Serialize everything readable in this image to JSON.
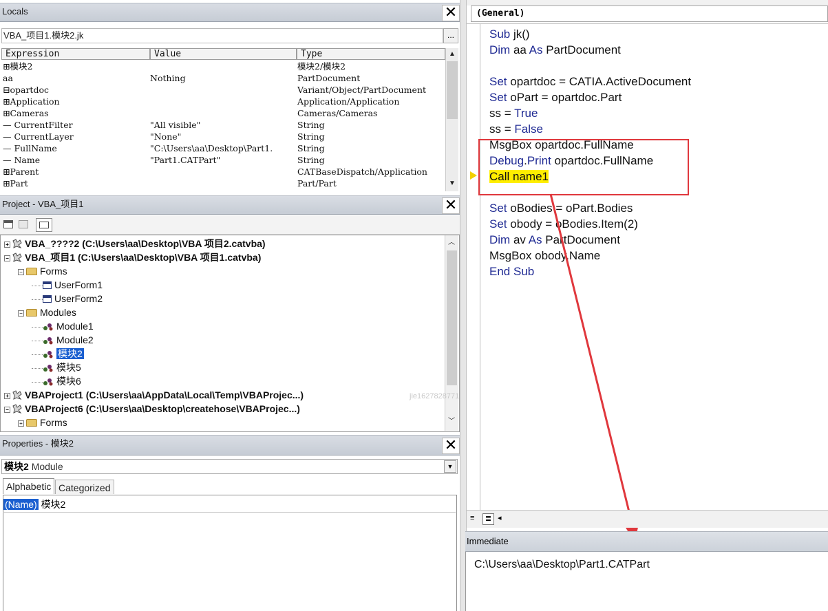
{
  "locals": {
    "title": "Locals",
    "context": "VBA_项目1.模块2.jk",
    "ellipsis": "...",
    "columns": [
      "Expression",
      "Value",
      "Type"
    ],
    "rows": [
      {
        "expr": "⊞模块2",
        "value": "",
        "type": "模块2/模块2"
      },
      {
        "expr": " aa",
        "value": "Nothing",
        "type": "PartDocument"
      },
      {
        "expr": "⊟opartdoc",
        "value": "",
        "type": "Variant/Object/PartDocument"
      },
      {
        "expr": " ⊞Application",
        "value": "",
        "type": "Application/Application"
      },
      {
        "expr": " ⊞Cameras",
        "value": "",
        "type": "Cameras/Cameras"
      },
      {
        "expr": " — CurrentFilter",
        "value": "\"All visible\"",
        "type": "String"
      },
      {
        "expr": " — CurrentLayer",
        "value": "\"None\"",
        "type": "String"
      },
      {
        "expr": " — FullName",
        "value": "\"C:\\Users\\aa\\Desktop\\Part1.",
        "type": "String"
      },
      {
        "expr": " — Name",
        "value": "\"Part1.CATPart\"",
        "type": "String"
      },
      {
        "expr": " ⊞Parent",
        "value": "",
        "type": "CATBaseDispatch/Application"
      },
      {
        "expr": " ⊞Part",
        "value": "",
        "type": "Part/Part"
      }
    ]
  },
  "project": {
    "title": "Project - VBA_项目1",
    "tree": [
      {
        "label": "VBA_????2 (C:\\Users\\aa\\Desktop\\VBA 项目2.catvba)",
        "kind": "project",
        "expander": "+"
      },
      {
        "label": "VBA_项目1 (C:\\Users\\aa\\Desktop\\VBA 项目1.catvba)",
        "kind": "project",
        "expander": "−"
      },
      {
        "label": "Forms",
        "kind": "folder",
        "expander": "−"
      },
      {
        "label": "UserForm1",
        "kind": "form"
      },
      {
        "label": "UserForm2",
        "kind": "form"
      },
      {
        "label": "Modules",
        "kind": "folder",
        "expander": "−"
      },
      {
        "label": "Module1",
        "kind": "module"
      },
      {
        "label": "Module2",
        "kind": "module"
      },
      {
        "label": "模块2",
        "kind": "module",
        "selected": true
      },
      {
        "label": "模块5",
        "kind": "module"
      },
      {
        "label": "模块6",
        "kind": "module"
      },
      {
        "label": "VBAProject1 (C:\\Users\\aa\\AppData\\Local\\Temp\\VBAProjec...)",
        "kind": "project",
        "expander": "+"
      },
      {
        "label": "VBAProject6 (C:\\Users\\aa\\Desktop\\createhose\\VBAProjec...)",
        "kind": "project",
        "expander": "−"
      },
      {
        "label": "Forms",
        "kind": "folder",
        "expander": "+"
      }
    ]
  },
  "properties": {
    "title": "Properties - 模块2",
    "object_name": "模块2",
    "object_type": "Module",
    "tabs": [
      "Alphabetic",
      "Categorized"
    ],
    "rows": [
      {
        "name": "(Name)",
        "value": "模块2"
      }
    ]
  },
  "code": {
    "object_combo": "(General)",
    "lines": [
      [
        {
          "t": "Sub ",
          "k": true
        },
        {
          "t": "jk()"
        }
      ],
      [
        {
          "t": "Dim ",
          "k": true
        },
        {
          "t": "aa "
        },
        {
          "t": "As ",
          "k": true
        },
        {
          "t": "PartDocument"
        }
      ],
      [],
      [
        {
          "t": "Set ",
          "k": true
        },
        {
          "t": "opartdoc = CATIA.ActiveDocument"
        }
      ],
      [
        {
          "t": "Set ",
          "k": true
        },
        {
          "t": "oPart = opartdoc.Part"
        }
      ],
      [
        {
          "t": "ss = "
        },
        {
          "t": "True",
          "k": true
        }
      ],
      [
        {
          "t": "ss = "
        },
        {
          "t": "False",
          "k": true
        }
      ],
      [
        {
          "t": "MsgBox opartdoc.FullName"
        }
      ],
      [
        {
          "t": "Debug",
          "k": true
        },
        {
          "t": "."
        },
        {
          "t": "Print",
          "k": true
        },
        {
          "t": " opartdoc.FullName"
        }
      ],
      [
        {
          "t": "Call name1",
          "hl": true
        }
      ],
      [],
      [
        {
          "t": "Set ",
          "k": true
        },
        {
          "t": "oBodies = oPart.Bodies"
        }
      ],
      [
        {
          "t": "Set ",
          "k": true
        },
        {
          "t": "obody = oBodies.Item(2)"
        }
      ],
      [
        {
          "t": "Dim ",
          "k": true
        },
        {
          "t": "av "
        },
        {
          "t": "As ",
          "k": true
        },
        {
          "t": "PartDocument"
        }
      ],
      [
        {
          "t": "MsgBox obody.Name"
        }
      ],
      [
        {
          "t": "End Sub",
          "k": true
        }
      ]
    ]
  },
  "immediate": {
    "title": "Immediate",
    "output": "C:\\Users\\aa\\Desktop\\Part1.CATPart"
  },
  "watermark": "jie1627828771",
  "colors": {
    "keyword": "#1f2a93",
    "highlight": "#ffee00",
    "annotation": "#e0383d",
    "selection": "#1a5fd0"
  }
}
